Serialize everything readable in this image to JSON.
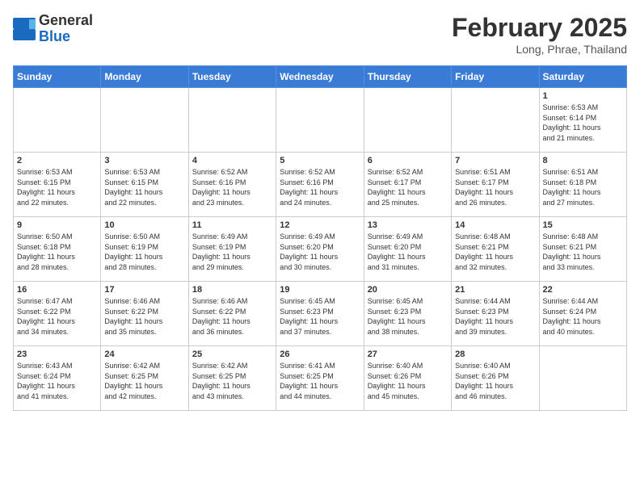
{
  "header": {
    "logo": {
      "line1": "General",
      "line2": "Blue"
    },
    "title": "February 2025",
    "subtitle": "Long, Phrae, Thailand"
  },
  "weekdays": [
    "Sunday",
    "Monday",
    "Tuesday",
    "Wednesday",
    "Thursday",
    "Friday",
    "Saturday"
  ],
  "weeks": [
    [
      {
        "day": "",
        "info": ""
      },
      {
        "day": "",
        "info": ""
      },
      {
        "day": "",
        "info": ""
      },
      {
        "day": "",
        "info": ""
      },
      {
        "day": "",
        "info": ""
      },
      {
        "day": "",
        "info": ""
      },
      {
        "day": "1",
        "info": "Sunrise: 6:53 AM\nSunset: 6:14 PM\nDaylight: 11 hours\nand 21 minutes."
      }
    ],
    [
      {
        "day": "2",
        "info": "Sunrise: 6:53 AM\nSunset: 6:15 PM\nDaylight: 11 hours\nand 22 minutes."
      },
      {
        "day": "3",
        "info": "Sunrise: 6:53 AM\nSunset: 6:15 PM\nDaylight: 11 hours\nand 22 minutes."
      },
      {
        "day": "4",
        "info": "Sunrise: 6:52 AM\nSunset: 6:16 PM\nDaylight: 11 hours\nand 23 minutes."
      },
      {
        "day": "5",
        "info": "Sunrise: 6:52 AM\nSunset: 6:16 PM\nDaylight: 11 hours\nand 24 minutes."
      },
      {
        "day": "6",
        "info": "Sunrise: 6:52 AM\nSunset: 6:17 PM\nDaylight: 11 hours\nand 25 minutes."
      },
      {
        "day": "7",
        "info": "Sunrise: 6:51 AM\nSunset: 6:17 PM\nDaylight: 11 hours\nand 26 minutes."
      },
      {
        "day": "8",
        "info": "Sunrise: 6:51 AM\nSunset: 6:18 PM\nDaylight: 11 hours\nand 27 minutes."
      }
    ],
    [
      {
        "day": "9",
        "info": "Sunrise: 6:50 AM\nSunset: 6:18 PM\nDaylight: 11 hours\nand 28 minutes."
      },
      {
        "day": "10",
        "info": "Sunrise: 6:50 AM\nSunset: 6:19 PM\nDaylight: 11 hours\nand 28 minutes."
      },
      {
        "day": "11",
        "info": "Sunrise: 6:49 AM\nSunset: 6:19 PM\nDaylight: 11 hours\nand 29 minutes."
      },
      {
        "day": "12",
        "info": "Sunrise: 6:49 AM\nSunset: 6:20 PM\nDaylight: 11 hours\nand 30 minutes."
      },
      {
        "day": "13",
        "info": "Sunrise: 6:49 AM\nSunset: 6:20 PM\nDaylight: 11 hours\nand 31 minutes."
      },
      {
        "day": "14",
        "info": "Sunrise: 6:48 AM\nSunset: 6:21 PM\nDaylight: 11 hours\nand 32 minutes."
      },
      {
        "day": "15",
        "info": "Sunrise: 6:48 AM\nSunset: 6:21 PM\nDaylight: 11 hours\nand 33 minutes."
      }
    ],
    [
      {
        "day": "16",
        "info": "Sunrise: 6:47 AM\nSunset: 6:22 PM\nDaylight: 11 hours\nand 34 minutes."
      },
      {
        "day": "17",
        "info": "Sunrise: 6:46 AM\nSunset: 6:22 PM\nDaylight: 11 hours\nand 35 minutes."
      },
      {
        "day": "18",
        "info": "Sunrise: 6:46 AM\nSunset: 6:22 PM\nDaylight: 11 hours\nand 36 minutes."
      },
      {
        "day": "19",
        "info": "Sunrise: 6:45 AM\nSunset: 6:23 PM\nDaylight: 11 hours\nand 37 minutes."
      },
      {
        "day": "20",
        "info": "Sunrise: 6:45 AM\nSunset: 6:23 PM\nDaylight: 11 hours\nand 38 minutes."
      },
      {
        "day": "21",
        "info": "Sunrise: 6:44 AM\nSunset: 6:23 PM\nDaylight: 11 hours\nand 39 minutes."
      },
      {
        "day": "22",
        "info": "Sunrise: 6:44 AM\nSunset: 6:24 PM\nDaylight: 11 hours\nand 40 minutes."
      }
    ],
    [
      {
        "day": "23",
        "info": "Sunrise: 6:43 AM\nSunset: 6:24 PM\nDaylight: 11 hours\nand 41 minutes."
      },
      {
        "day": "24",
        "info": "Sunrise: 6:42 AM\nSunset: 6:25 PM\nDaylight: 11 hours\nand 42 minutes."
      },
      {
        "day": "25",
        "info": "Sunrise: 6:42 AM\nSunset: 6:25 PM\nDaylight: 11 hours\nand 43 minutes."
      },
      {
        "day": "26",
        "info": "Sunrise: 6:41 AM\nSunset: 6:25 PM\nDaylight: 11 hours\nand 44 minutes."
      },
      {
        "day": "27",
        "info": "Sunrise: 6:40 AM\nSunset: 6:26 PM\nDaylight: 11 hours\nand 45 minutes."
      },
      {
        "day": "28",
        "info": "Sunrise: 6:40 AM\nSunset: 6:26 PM\nDaylight: 11 hours\nand 46 minutes."
      },
      {
        "day": "",
        "info": ""
      }
    ]
  ]
}
